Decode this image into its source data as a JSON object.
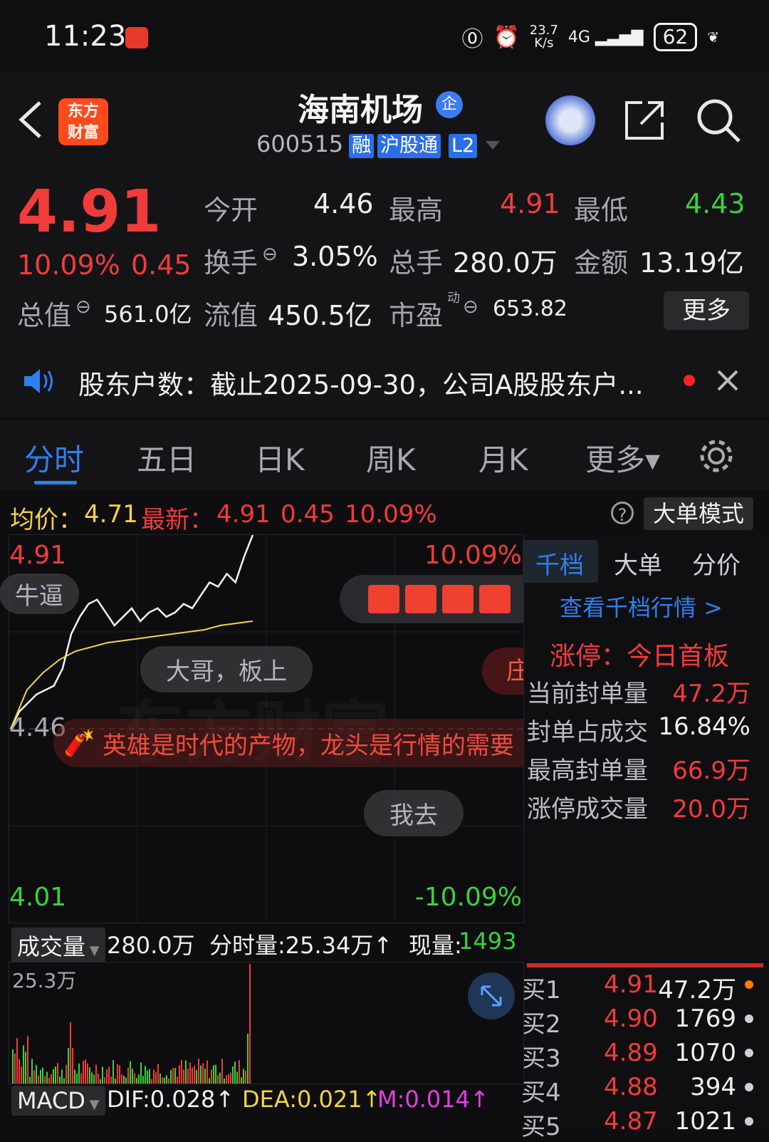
{
  "status": {
    "time": "11:23",
    "speed": "23.7\nK/s",
    "network": "4G",
    "battery": "62"
  },
  "header": {
    "stock_name": "海南机场",
    "qi_badge": "企",
    "stock_code": "600515",
    "tags": [
      "融",
      "沪股通",
      "L2"
    ],
    "logo_text": "东方\n财富"
  },
  "quote": {
    "price": "4.91",
    "change_pct": "10.09%",
    "change_amt": "0.45",
    "open_label": "今开",
    "open_value": "4.46",
    "high_label": "最高",
    "high_value": "4.91",
    "low_label": "最低",
    "low_value": "4.43",
    "turnover_label": "换手",
    "turnover_value": "3.05%",
    "volume_label": "总手",
    "volume_value": "280.0万",
    "amount_label": "金额",
    "amount_value": "13.19亿",
    "mktcap_label": "总值",
    "mktcap_value": "561.0亿",
    "float_label": "流值",
    "float_value": "450.5亿",
    "pe_label": "市盈",
    "pe_sup": "动",
    "pe_value": "653.82",
    "more_button": "更多"
  },
  "notice": {
    "text": "股东户数：截止2025-09-30，公司A股股东户..."
  },
  "tabs": [
    "分时",
    "五日",
    "日K",
    "周K",
    "月K",
    "更多▾"
  ],
  "infobar": {
    "avg_label": "均价：",
    "avg_value": "4.71",
    "latest_label": "最新：",
    "latest_value": "4.91",
    "chg_amt": "0.45",
    "chg_pct": "10.09%",
    "big_order_button": "大单模式"
  },
  "chart": {
    "top_price": "4.91",
    "top_pct": "10.09%",
    "mid_price": "4.46",
    "bottom_price": "4.01",
    "bottom_pct": "-10.09%",
    "bubble_1": "牛逼",
    "bubble_2": "大哥，板上",
    "bubble_3": "我去",
    "bubble_4": "庄",
    "banner": "英雄是时代的产物，龙头是行情的需要",
    "watermark": "东方财富"
  },
  "chart_data": {
    "type": "line",
    "title": "",
    "ylim": [
      4.01,
      4.91
    ],
    "series": [
      {
        "values": [
          4.46,
          4.5,
          4.52,
          4.54,
          4.55,
          4.56,
          4.6,
          4.68,
          4.72,
          4.75,
          4.76,
          4.73,
          4.7,
          4.72,
          4.74,
          4.71,
          4.73,
          4.74,
          4.72,
          4.73,
          4.75,
          4.74,
          4.77,
          4.8,
          4.79,
          4.82,
          4.8,
          4.86,
          4.91
        ]
      },
      {
        "values": [
          4.46,
          4.55,
          4.59,
          4.62,
          4.64,
          4.65,
          4.66,
          4.665,
          4.67,
          4.675,
          4.68,
          4.685,
          4.69,
          4.7,
          4.705,
          4.71
        ]
      }
    ]
  },
  "right_panel": {
    "tabs": [
      "千档",
      "大单",
      "分价"
    ],
    "link": "查看千档行情 >",
    "limit_title": "涨停：今日首板",
    "rows": [
      {
        "label": "当前封单量",
        "value": "47.2万"
      },
      {
        "label": "封单占成交",
        "value": "16.84%"
      },
      {
        "label": "最高封单量",
        "value": "66.9万"
      },
      {
        "label": "涨停成交量",
        "value": "20.0万"
      }
    ],
    "bids": [
      {
        "label": "买1",
        "price": "4.91",
        "qty": "47.2万"
      },
      {
        "label": "买2",
        "price": "4.90",
        "qty": "1769"
      },
      {
        "label": "买3",
        "price": "4.89",
        "qty": "1070"
      },
      {
        "label": "买4",
        "price": "4.88",
        "qty": "394"
      },
      {
        "label": "买5",
        "price": "4.87",
        "qty": "1021"
      }
    ]
  },
  "volume": {
    "selector": "成交量",
    "total": "280.0万",
    "tick_label": "分时量:25.34万↑",
    "now_label": "现量:",
    "now_value": "1493",
    "max_label": "25.3万"
  },
  "macd": {
    "selector": "MACD",
    "dif": "DIF:0.028↑",
    "dea": "DEA:0.021↑",
    "m": "M:0.014↑"
  }
}
